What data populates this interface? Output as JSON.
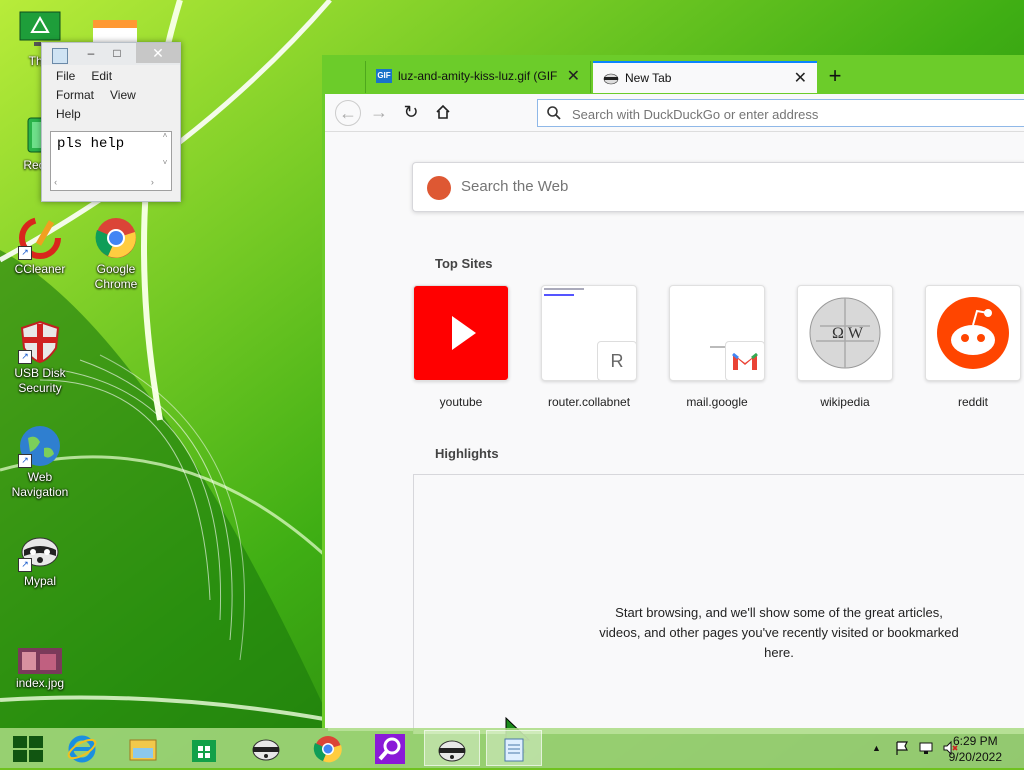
{
  "desktop": {
    "icons": [
      {
        "label": "This",
        "icon": "computer-icon"
      },
      {
        "label": "Recyc",
        "icon": "recycle-bin-icon"
      },
      {
        "label": "CCleaner",
        "icon": "ccleaner-icon"
      },
      {
        "label": "Google Chrome",
        "icon": "chrome-icon"
      },
      {
        "label": "USB Disk Security",
        "icon": "shield-icon"
      },
      {
        "label": "Web Navigation",
        "icon": "globe-icon"
      },
      {
        "label": "Mypal",
        "icon": "raccoon-icon"
      },
      {
        "label": "index.jpg",
        "icon": "image-icon"
      }
    ]
  },
  "notepad": {
    "title": "",
    "menu": [
      "File",
      "Edit",
      "Format",
      "View",
      "Help"
    ],
    "text": "pls help",
    "min_label": "‒",
    "max_label": "□",
    "close_label": "✕"
  },
  "browser": {
    "tabs": [
      {
        "title": "luz-and-amity-kiss-luz.gif (GIF",
        "icon": "gif-icon",
        "close": "✕"
      },
      {
        "title": "New Tab",
        "icon": "raccoon-icon",
        "close": "✕"
      }
    ],
    "new_tab_label": "+",
    "url_placeholder": "Search with DuckDuckGo or enter address",
    "search_placeholder": "Search the Web",
    "top_sites_heading": "Top Sites",
    "top_sites": [
      {
        "label": "youtube",
        "icon": "youtube-icon"
      },
      {
        "label": "router.collabnet",
        "icon": "letter-r-icon",
        "badge": "R"
      },
      {
        "label": "mail.google",
        "icon": "gmail-icon"
      },
      {
        "label": "wikipedia",
        "icon": "wikipedia-icon"
      },
      {
        "label": "reddit",
        "icon": "reddit-icon"
      }
    ],
    "highlights_heading": "Highlights",
    "highlights_message": "Start browsing, and we'll show some of the great articles, videos, and other pages you've recently visited or bookmarked here."
  },
  "taskbar": {
    "items": [
      "start-icon",
      "internet-explorer-icon",
      "file-explorer-icon",
      "store-icon",
      "mypal-icon",
      "chrome-icon",
      "search-app-icon",
      "mypal-icon",
      "notepad-icon"
    ],
    "time": "6:29 PM",
    "date": "9/20/2022",
    "tray_arrow": "▲"
  },
  "colors": {
    "accent": "#0a84ff",
    "wallpaper": "#6fc21f",
    "tab_strip": "#6ccc2a"
  }
}
